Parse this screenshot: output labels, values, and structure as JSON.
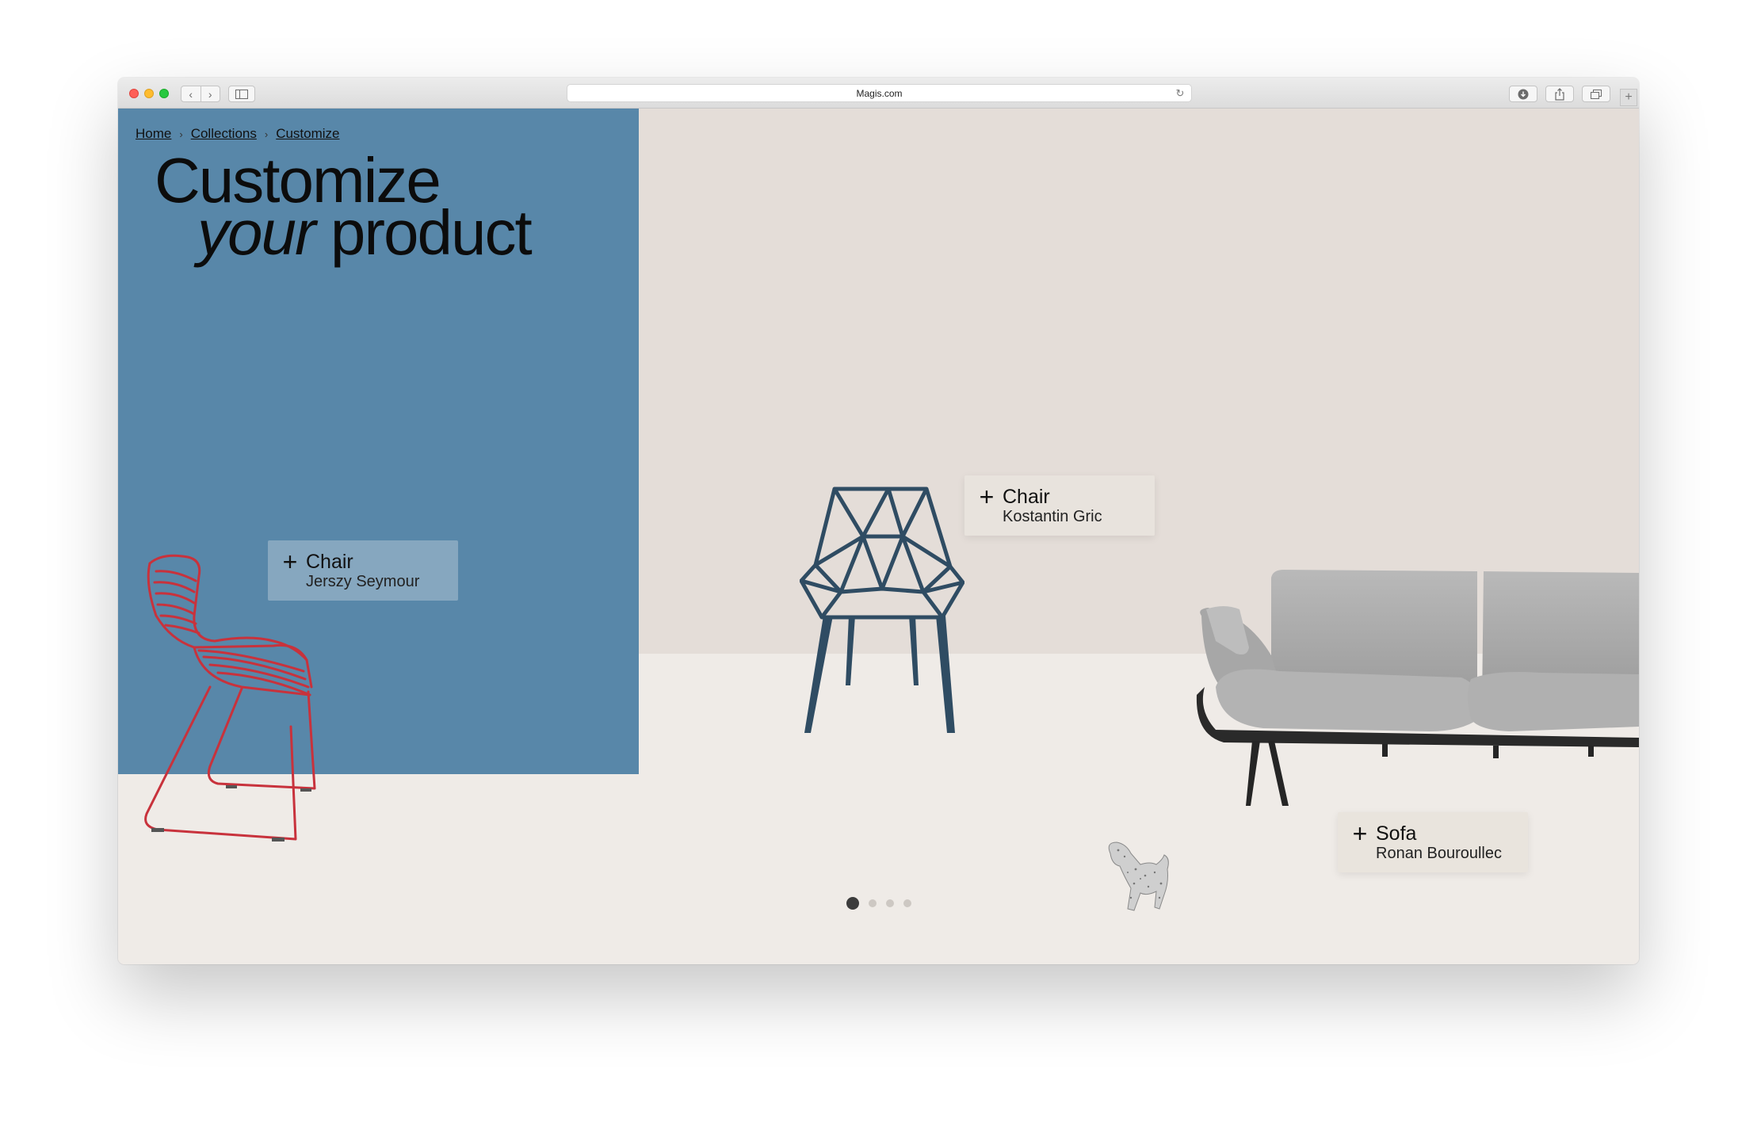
{
  "browser": {
    "url": "Magis.com",
    "back_glyph": "‹",
    "forward_glyph": "›",
    "reload_glyph": "↻",
    "new_tab_glyph": "+"
  },
  "breadcrumb": {
    "items": [
      "Home",
      "Collections",
      "Customize"
    ],
    "separator": "›"
  },
  "hero": {
    "line1": "Customize",
    "line2_italic": "your",
    "line2_rest": "product"
  },
  "products": [
    {
      "type": "Chair",
      "designer": "Jerszy Seymour"
    },
    {
      "type": "Chair",
      "designer": "Kostantin Gric"
    },
    {
      "type": "Sofa",
      "designer": "Ronan Bouroullec"
    }
  ],
  "tag_plus": "+",
  "carousel": {
    "count": 4,
    "active": 1
  },
  "colors": {
    "blue_panel": "#5887a9",
    "wall": "#e4ddd8",
    "floor": "#efebe7",
    "red_chair": "#c8323c",
    "blue_chair": "#2f4c63",
    "sofa": "#a9a9a9"
  },
  "icons": [
    "back-icon",
    "forward-icon",
    "sidebar-icon",
    "reload-icon",
    "download-icon",
    "share-icon",
    "tabs-icon",
    "plus-icon"
  ]
}
